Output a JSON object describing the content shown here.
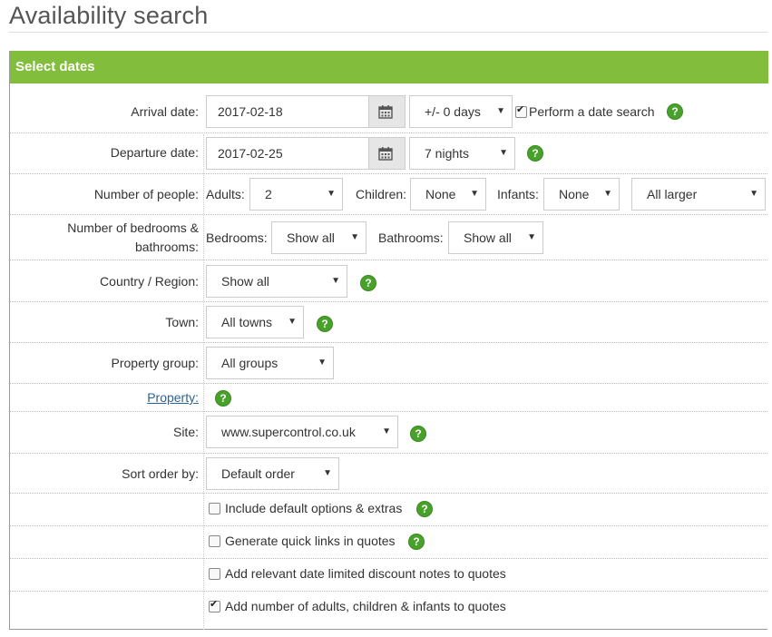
{
  "page_title": "Availability search",
  "panel": {
    "title": "Select dates"
  },
  "arrival": {
    "label": "Arrival date:",
    "value": "2017-02-18",
    "flex": "+/- 0 days",
    "date_search_label": "Perform a date search",
    "date_search_checked": true
  },
  "departure": {
    "label": "Departure date:",
    "value": "2017-02-25",
    "nights": "7 nights"
  },
  "people": {
    "label": "Number of people:",
    "adults_label": "Adults:",
    "adults": "2",
    "children_label": "Children:",
    "children": "None",
    "infants_label": "Infants:",
    "infants": "None",
    "size": "All larger"
  },
  "rooms": {
    "label_line1": "Number of bedrooms &",
    "label_line2": "bathrooms:",
    "bedrooms_label": "Bedrooms:",
    "bedrooms": "Show all",
    "bathrooms_label": "Bathrooms:",
    "bathrooms": "Show all"
  },
  "country": {
    "label": "Country / Region:",
    "value": "Show all"
  },
  "town": {
    "label": "Town:",
    "value": "All towns"
  },
  "group": {
    "label": "Property group:",
    "value": "All groups"
  },
  "property": {
    "label": "Property:"
  },
  "site": {
    "label": "Site:",
    "value": "www.supercontrol.co.uk"
  },
  "sort": {
    "label": "Sort order by:",
    "value": "Default order"
  },
  "options": [
    {
      "label": "Include default options & extras",
      "checked": false
    },
    {
      "label": "Generate quick links in quotes",
      "checked": false
    },
    {
      "label": "Add relevant date limited discount notes to quotes",
      "checked": false
    },
    {
      "label": "Add number of adults, children & infants to quotes",
      "checked": true
    }
  ],
  "icons": {
    "calendar": "calendar-icon",
    "help": "help-icon",
    "caret": "caret-down-icon"
  },
  "colors": {
    "header": "#82bd3c",
    "help": "#48a12a",
    "link": "#2a6496"
  }
}
